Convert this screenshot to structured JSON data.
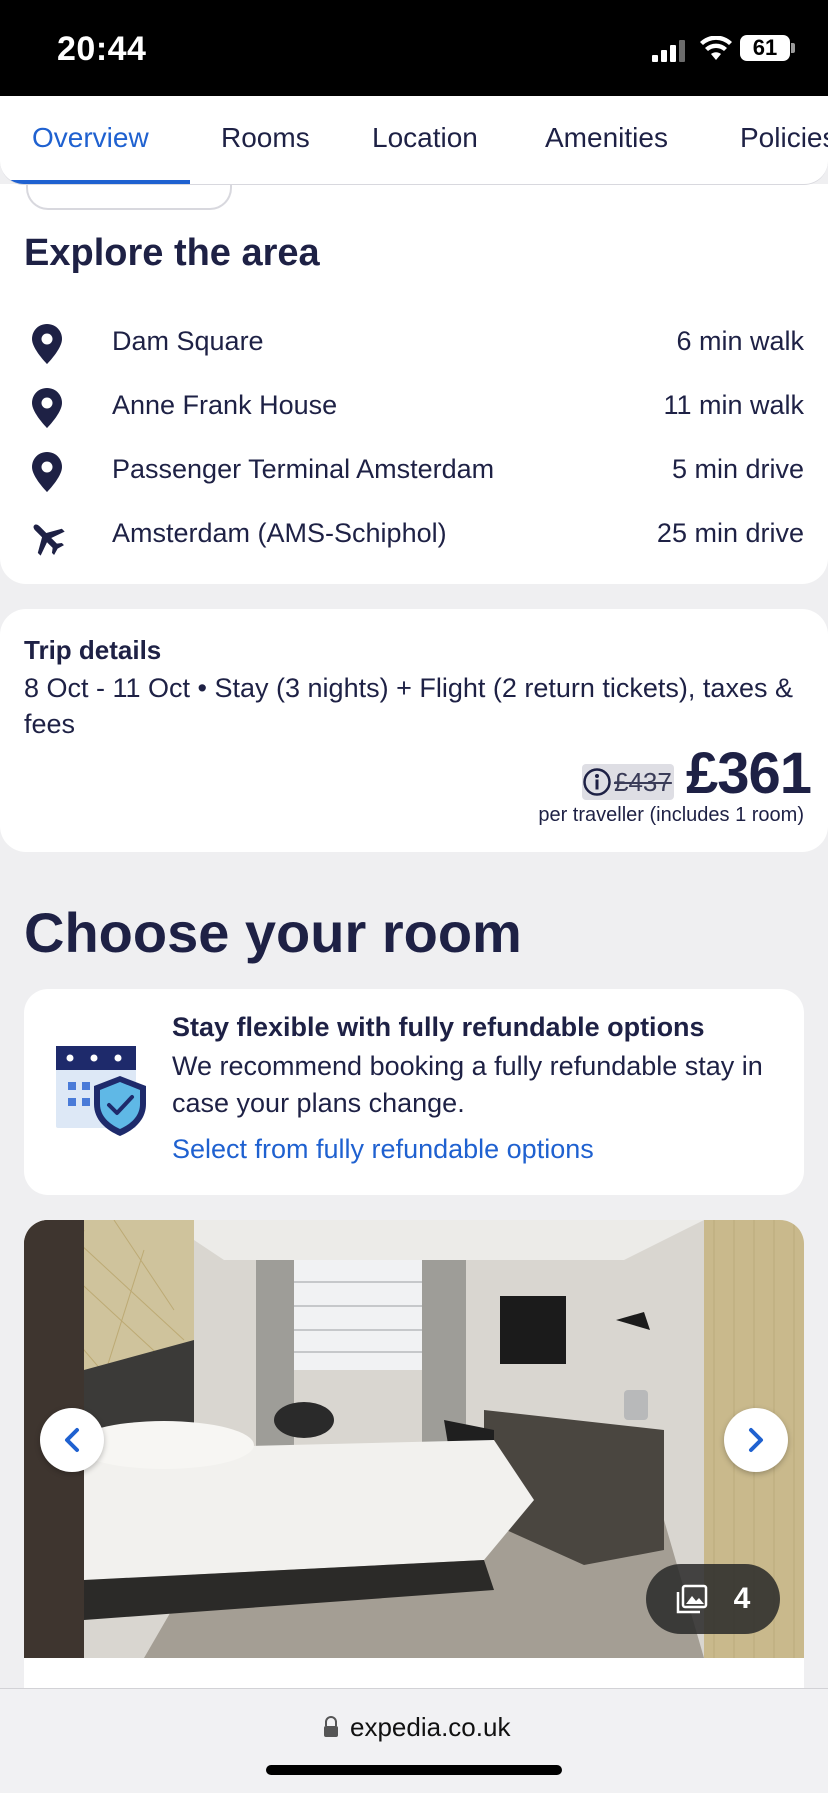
{
  "status_bar": {
    "time": "20:44",
    "battery": "61"
  },
  "tabs": [
    {
      "label": "Overview",
      "active": true
    },
    {
      "label": "Rooms"
    },
    {
      "label": "Location"
    },
    {
      "label": "Amenities"
    },
    {
      "label": "Policies"
    }
  ],
  "explore": {
    "title": "Explore the area",
    "places": [
      {
        "icon": "map-pin-icon",
        "name": "Dam Square",
        "distance": "6 min walk"
      },
      {
        "icon": "map-pin-icon",
        "name": "Anne Frank House",
        "distance": "11 min walk"
      },
      {
        "icon": "map-pin-icon",
        "name": "Passenger Terminal Amsterdam",
        "distance": "5 min drive"
      },
      {
        "icon": "airplane-icon",
        "name": "Amsterdam (AMS-Schiphol)",
        "distance": "25 min drive"
      }
    ]
  },
  "trip": {
    "title": "Trip details",
    "description": "8 Oct - 11 Oct • Stay (3 nights) + Flight (2 return tickets), taxes & fees",
    "old_price": "£437",
    "price": "£361",
    "price_note": "per traveller (includes 1 room)"
  },
  "rooms": {
    "title": "Choose your room",
    "refund": {
      "title": "Stay flexible with fully refundable options",
      "body": "We recommend booking a fully refundable stay in case your plans change.",
      "link": "Select from fully refundable options"
    },
    "gallery_count": "4"
  },
  "browser": {
    "url": "expedia.co.uk"
  },
  "colors": {
    "brand_blue": "#1f61d0",
    "navy": "#1e2145"
  }
}
